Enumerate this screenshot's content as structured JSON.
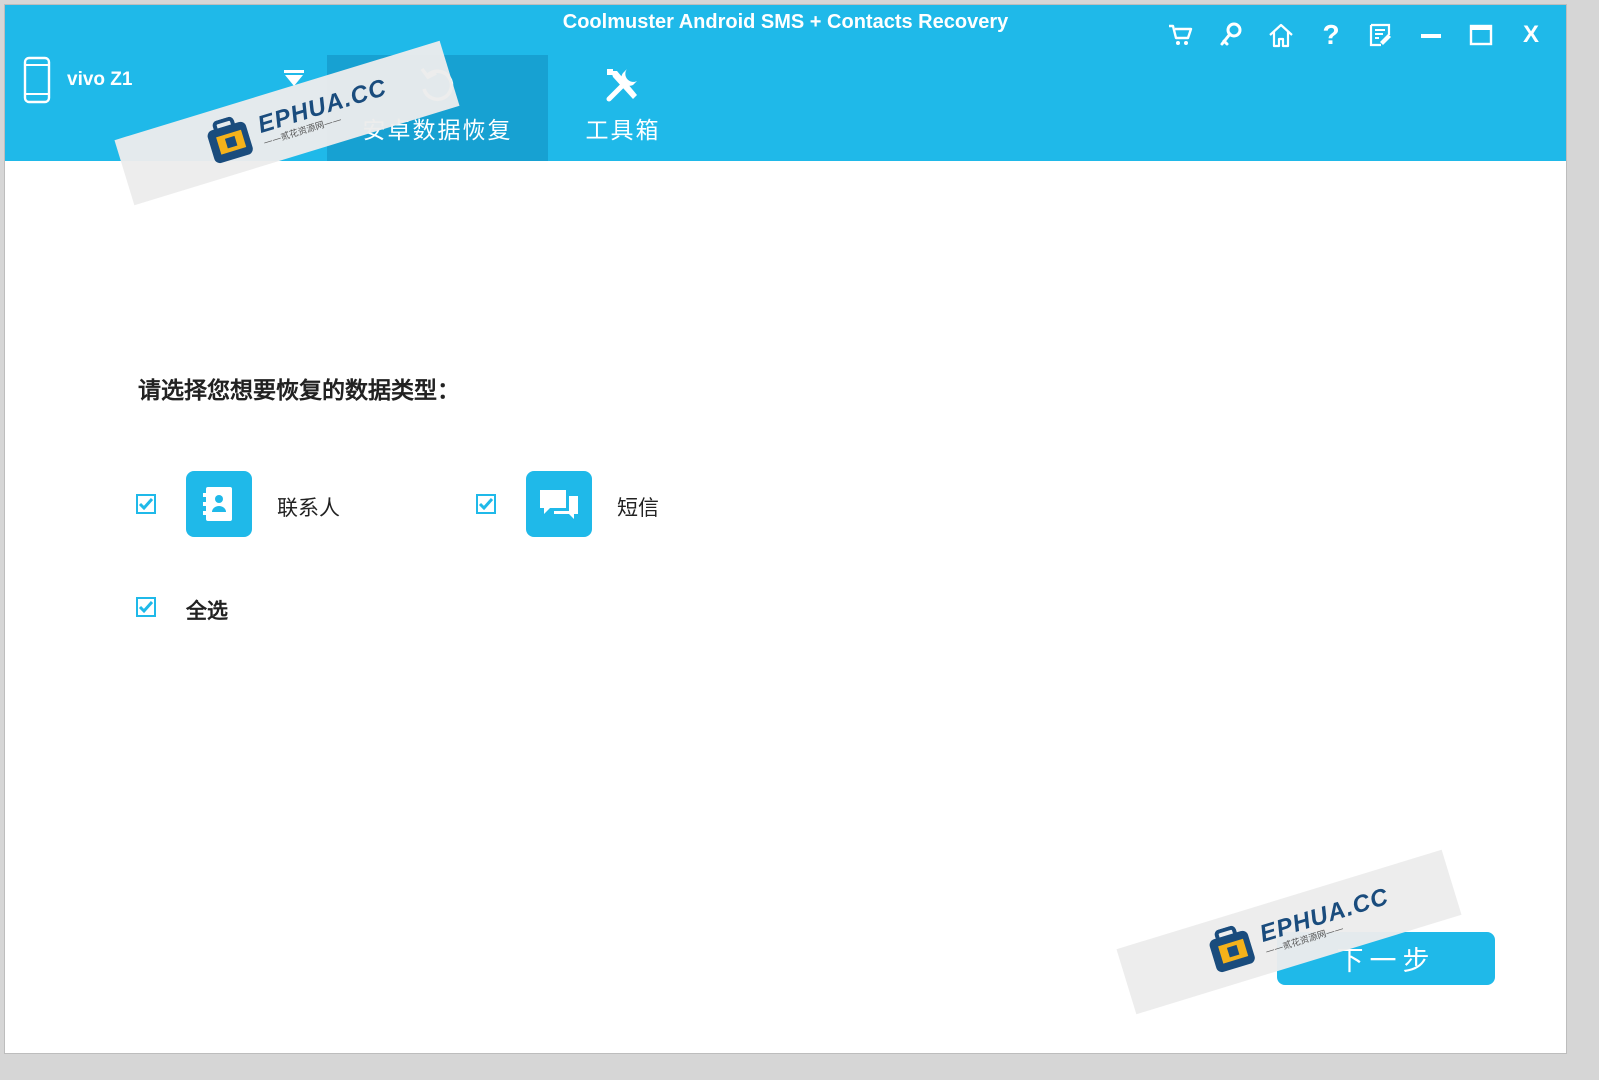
{
  "app": {
    "title": "Coolmuster Android SMS + Contacts Recovery"
  },
  "window_controls": [
    {
      "name": "cart-button",
      "icon": "cart-icon"
    },
    {
      "name": "register-button",
      "icon": "key-icon"
    },
    {
      "name": "home-button",
      "icon": "home-icon"
    },
    {
      "name": "help-button",
      "icon": "question-icon",
      "glyph": "?"
    },
    {
      "name": "feedback-button",
      "icon": "feedback-icon"
    },
    {
      "name": "minimize-button",
      "icon": "minimize-icon"
    },
    {
      "name": "maximize-button",
      "icon": "maximize-icon"
    },
    {
      "name": "close-button",
      "icon": "close-icon",
      "glyph": "X"
    }
  ],
  "device": {
    "name": "vivo Z1",
    "icon": "phone-icon",
    "dropdown_icon": "dropdown-triangle-icon"
  },
  "tabs": [
    {
      "label": "安卓数据恢复",
      "icon": "recovery-icon",
      "active": true
    },
    {
      "label": "工具箱",
      "icon": "tools-icon",
      "active": false
    }
  ],
  "main": {
    "prompt": "请选择您想要恢复的数据类型：",
    "options": [
      {
        "label": "联系人",
        "icon": "contacts-icon",
        "checked": true
      },
      {
        "label": "短信",
        "icon": "messages-icon",
        "checked": true
      }
    ],
    "select_all": {
      "label": "全选",
      "checked": true
    },
    "next_button": "下一步"
  },
  "watermark": {
    "brand": "EPHUA.CC",
    "sub": "——贰花资源网——"
  },
  "colors": {
    "accent": "#1fb9e9",
    "active_tab": "#17a1d2",
    "text": "#222222",
    "background": "#ffffff"
  }
}
